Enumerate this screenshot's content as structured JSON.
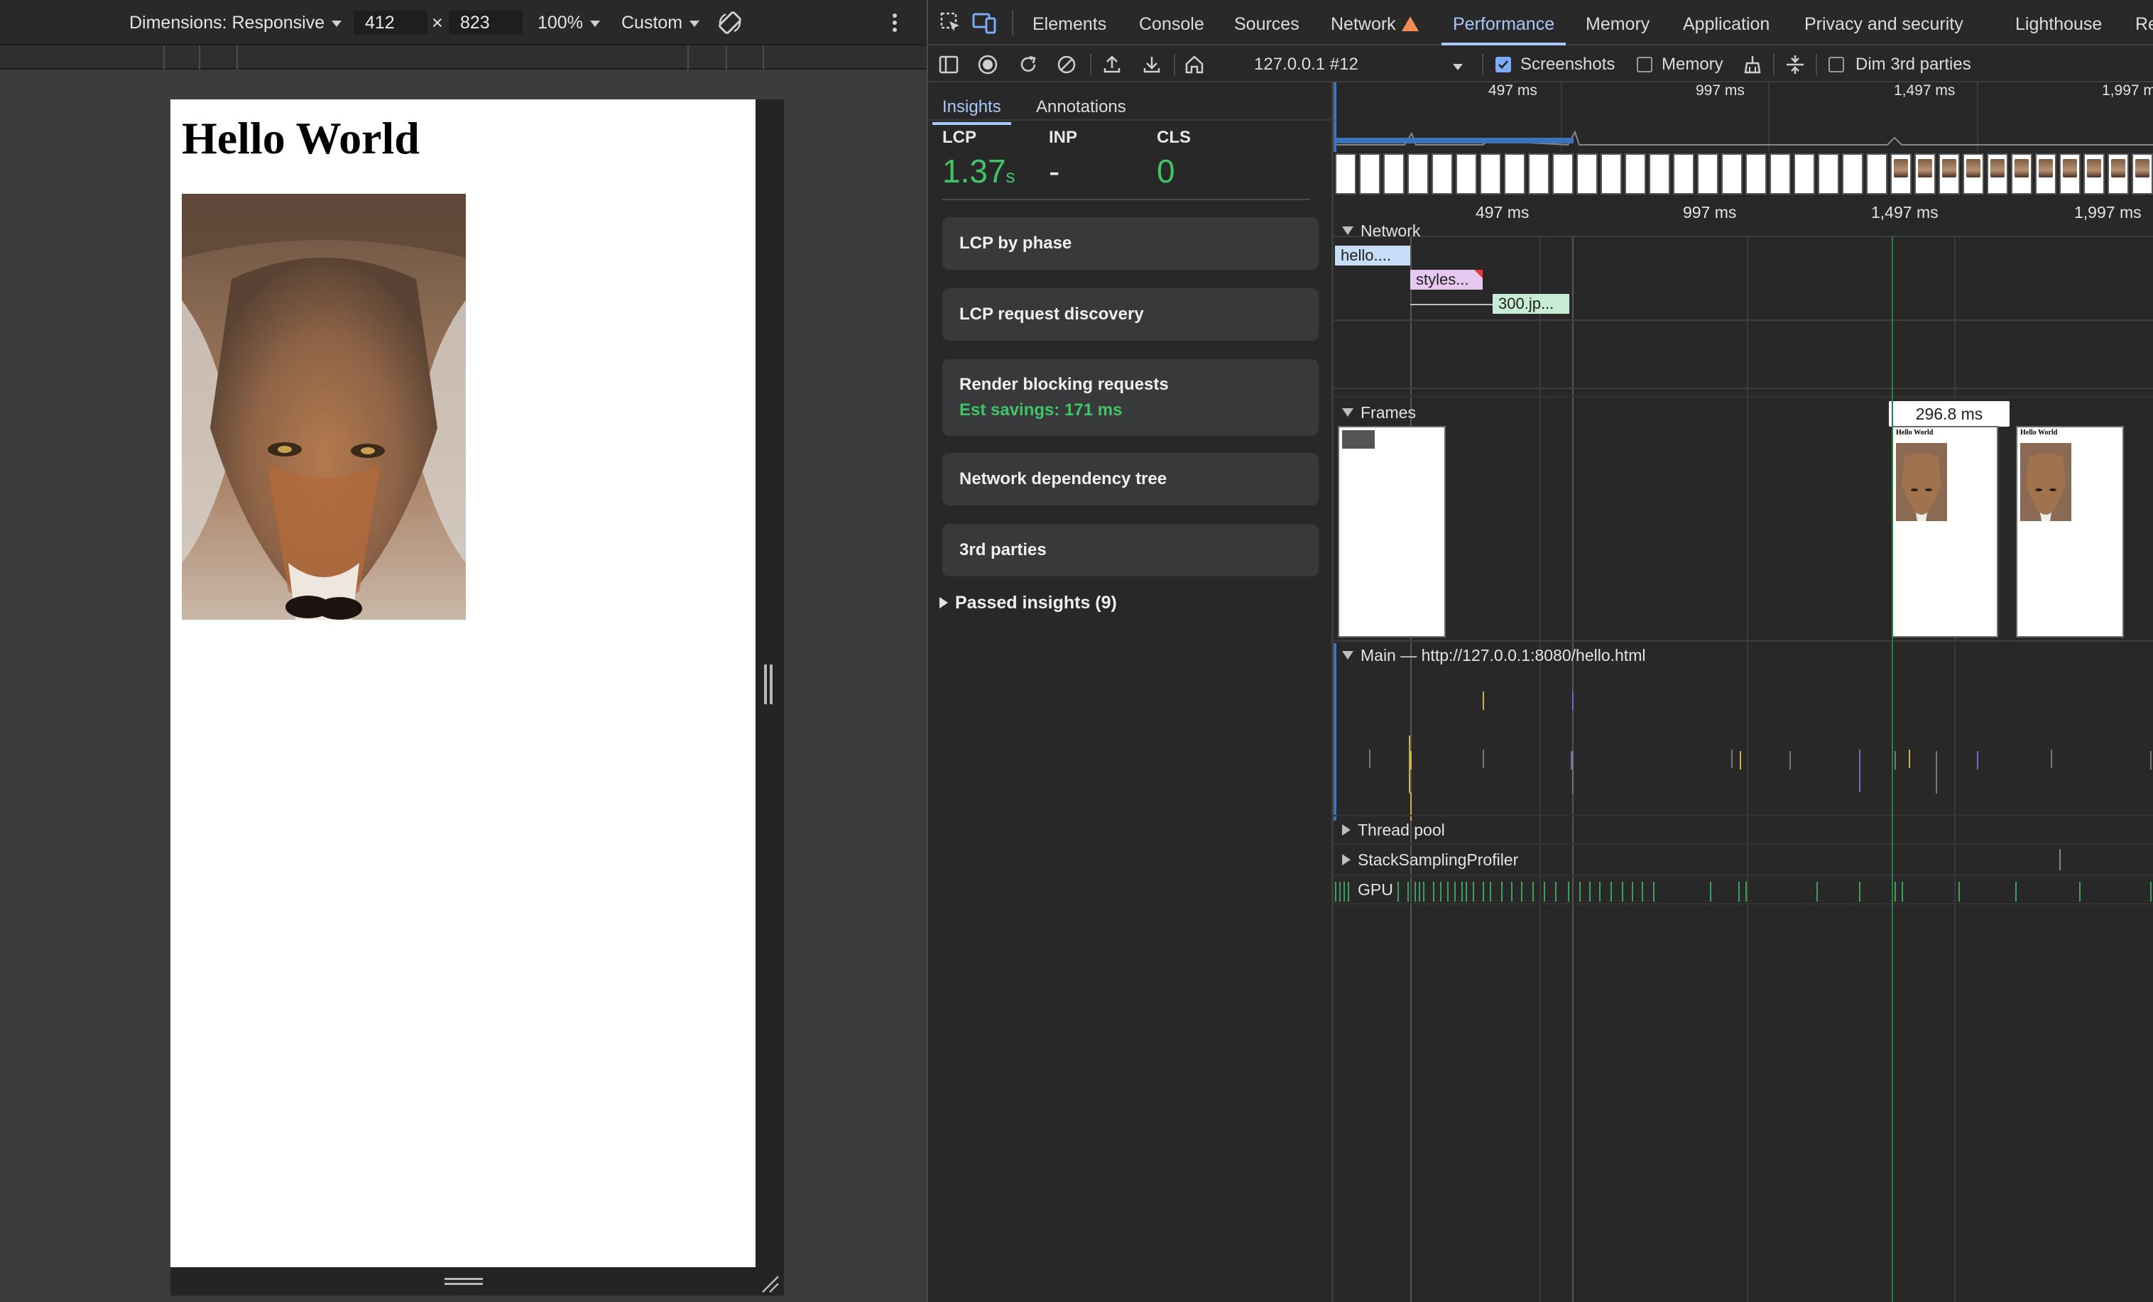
{
  "device_toolbar": {
    "dimensions_label": "Dimensions: Responsive",
    "width": "412",
    "height": "823",
    "times": "×",
    "zoom": "100%",
    "throttle": "Custom",
    "rotate_icon": "rotate-icon",
    "more_icon": "kebab-menu-icon"
  },
  "viewport_page": {
    "title": "Hello World",
    "image_alt": "coyote-photo"
  },
  "devtools_tabs": [
    "Elements",
    "Console",
    "Sources",
    "Network",
    "Performance",
    "Memory",
    "Application",
    "Privacy and security",
    "Lighthouse",
    "Re"
  ],
  "active_tab": "Performance",
  "perf_toolbar": {
    "recording": "127.0.0.1 #12",
    "screenshots_label": "Screenshots",
    "screenshots_checked": true,
    "memory_label": "Memory",
    "memory_checked": false,
    "dim_3rd_label": "Dim 3rd parties",
    "dim_3rd_checked": false
  },
  "sidebar": {
    "tabs": [
      "Insights",
      "Annotations"
    ],
    "active_tab": "Insights",
    "metrics": [
      {
        "label": "LCP",
        "value": "1.37",
        "unit": "s"
      },
      {
        "label": "INP",
        "value": "-",
        "unit": ""
      },
      {
        "label": "CLS",
        "value": "0",
        "unit": ""
      }
    ],
    "insights": [
      {
        "title": "LCP by phase"
      },
      {
        "title": "LCP request discovery"
      },
      {
        "title": "Render blocking requests",
        "savings": "Est savings: 171 ms"
      },
      {
        "title": "Network dependency tree"
      },
      {
        "title": "3rd parties"
      }
    ],
    "passed": "Passed insights (9)"
  },
  "timeline": {
    "overview_ticks": [
      "497 ms",
      "997 ms",
      "1,497 ms",
      "1,997 ms"
    ],
    "ruler_ticks": [
      "497 ms",
      "997 ms",
      "1,497 ms",
      "1,997 ms"
    ],
    "tracks": {
      "network": "Network",
      "frames": "Frames",
      "main": "Main — http://127.0.0.1:8080/hello.html",
      "thread_pool": "Thread pool",
      "stack_sampling": "StackSamplingProfiler",
      "gpu": "GPU"
    },
    "network_requests": [
      "hello....",
      "styles...",
      "300.jp..."
    ],
    "frame_tooltip": "296.8 ms",
    "screenshot_title": "Hello World",
    "colors": {
      "html": "#c7dcf7",
      "css": "#e6c8f0",
      "image": "#c8ecd4",
      "good_metric": "#3fc566",
      "accent": "#a8c7fa"
    }
  }
}
